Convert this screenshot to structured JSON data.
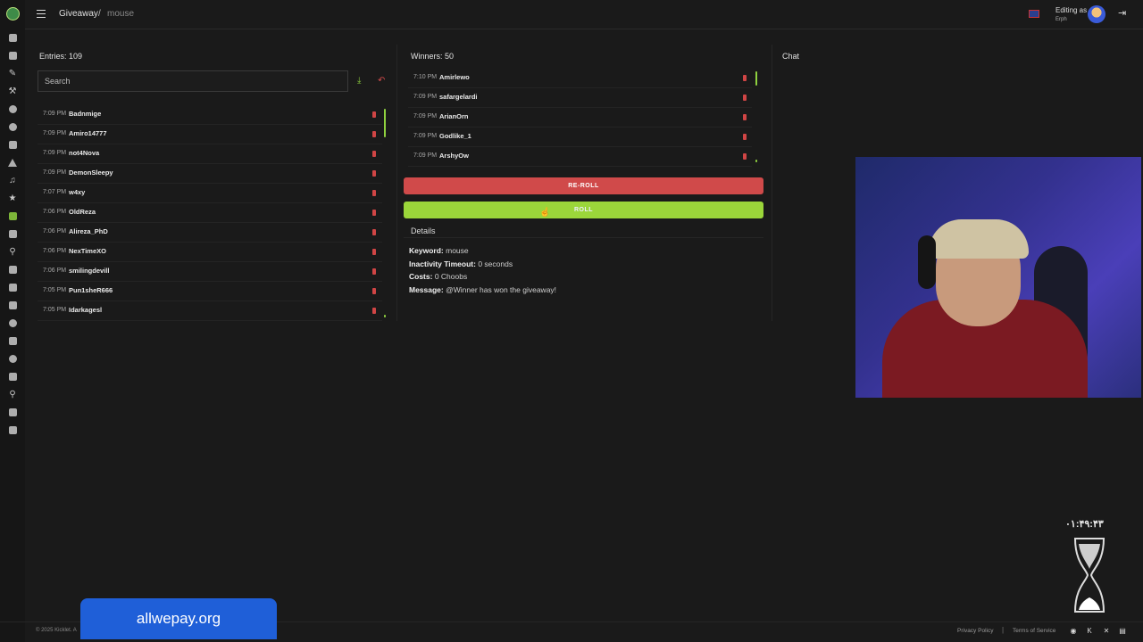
{
  "header": {
    "breadcrumb_main": "Giveaway",
    "breadcrumb_sep": "/",
    "breadcrumb_sub": "mouse",
    "editing_label": "Editing as",
    "editing_user": "Erph"
  },
  "entries": {
    "title": "Entries: 109",
    "search_placeholder": "Search",
    "rows": [
      {
        "time": "7:09 PM",
        "name": "Badnmige"
      },
      {
        "time": "7:09 PM",
        "name": "Amiro14777"
      },
      {
        "time": "7:09 PM",
        "name": "not4Nova"
      },
      {
        "time": "7:09 PM",
        "name": "DemonSleepy"
      },
      {
        "time": "7:07 PM",
        "name": "w4xy"
      },
      {
        "time": "7:06 PM",
        "name": "OldReza"
      },
      {
        "time": "7:06 PM",
        "name": "Alireza_PhD"
      },
      {
        "time": "7:06 PM",
        "name": "NexTimeXO"
      },
      {
        "time": "7:06 PM",
        "name": "smilingdevill"
      },
      {
        "time": "7:05 PM",
        "name": "Pun1sheR666"
      },
      {
        "time": "7:05 PM",
        "name": "Idarkagesl"
      }
    ]
  },
  "winners": {
    "title": "Winners: 50",
    "rows": [
      {
        "time": "7:10 PM",
        "name": "Amirlewo"
      },
      {
        "time": "7:09 PM",
        "name": "safargelardi"
      },
      {
        "time": "7:09 PM",
        "name": "ArianOrn"
      },
      {
        "time": "7:09 PM",
        "name": "Godlike_1"
      },
      {
        "time": "7:09 PM",
        "name": "ArshyOw"
      }
    ],
    "reroll_label": "RE-ROLL",
    "roll_label": "ROLL"
  },
  "details": {
    "title": "Details",
    "keyword_label": "Keyword:",
    "keyword_value": "mouse",
    "inactivity_label": "Inactivity Timeout:",
    "inactivity_value": "0 seconds",
    "costs_label": "Costs:",
    "costs_value": "0 Choobs",
    "message_label": "Message:",
    "message_value": "@Winner has won the giveaway!"
  },
  "chat": {
    "title": "Chat"
  },
  "overlay": {
    "timer": "۰۱:۴۹:۴۳",
    "promo_text": "allwepay.org"
  },
  "footer": {
    "copyright": "© 2025 Kicklet. A",
    "privacy": "Privacy Policy",
    "separator": "|",
    "terms": "Terms of Service"
  },
  "sidebar_icons": [
    "dashboard-icon",
    "document-icon",
    "pen-icon",
    "hammer-icon",
    "chat-icon",
    "clock-icon",
    "shield-icon",
    "alert-icon",
    "music-icon",
    "star-icon",
    "gift-icon",
    "cart-icon",
    "link-icon",
    "stats-icon",
    "video-icon",
    "calendar-icon",
    "smile-icon",
    "film-icon",
    "message-icon",
    "monitor-icon",
    "search-icon",
    "discord-icon",
    "card-icon"
  ],
  "colors": {
    "accent_green": "#9bd63a",
    "danger_red": "#d04a4a",
    "background": "#1a1a1a",
    "promo_blue": "#1f5fd8"
  }
}
